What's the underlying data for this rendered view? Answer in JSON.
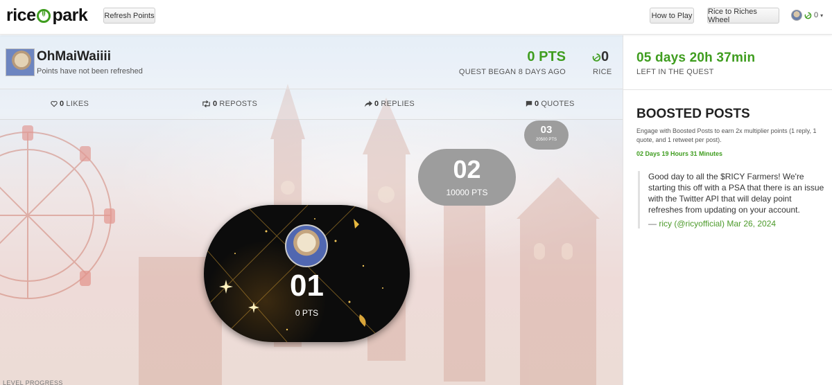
{
  "header": {
    "logo_left": "rice",
    "logo_right": "park",
    "refresh_label": "Refresh Points",
    "how_to_play_label": "How to Play",
    "wheel_label": "Rice to Riches Wheel",
    "user_rice_count": "0",
    "accent_green": "#3f9d1f"
  },
  "profile": {
    "username": "OhMaiWaiiii",
    "refresh_note": "Points have not been refreshed",
    "points_value": "0 PTS",
    "points_caption": "QUEST BEGAN 8 DAYS AGO",
    "rice_value": "0",
    "rice_caption": "RICE"
  },
  "stats": {
    "likes_count": "0",
    "likes_label": "LIKES",
    "reposts_count": "0",
    "reposts_label": "REPOSTS",
    "replies_count": "0",
    "replies_label": "REPLIES",
    "quotes_count": "0",
    "quotes_label": "QUOTES"
  },
  "leaderboard": [
    {
      "rank": "01",
      "points": "0 PTS"
    },
    {
      "rank": "02",
      "points": "10000 PTS"
    },
    {
      "rank": "03",
      "points": "20500 PTS"
    }
  ],
  "level_progress_label": "LEVEL PROGRESS",
  "sidebar": {
    "timer": "05 days 20h 37min",
    "timer_caption": "LEFT IN THE QUEST",
    "boosted_title": "BOOSTED POSTS",
    "boosted_desc": "Engage with Boosted Posts to earn 2x multiplier points (1 reply, 1 quote, and 1 retweet per post).",
    "boosted_countdown": "02 Days 19 Hours 31 Minutes",
    "tweet": {
      "text": "Good day to all the $RICY Farmers! We're starting this off with a PSA that there is an issue with the Twitter API that will delay point refreshes from updating on your account.",
      "author": "ricy (@ricyofficial)",
      "date": "Mar 26, 2024"
    }
  }
}
